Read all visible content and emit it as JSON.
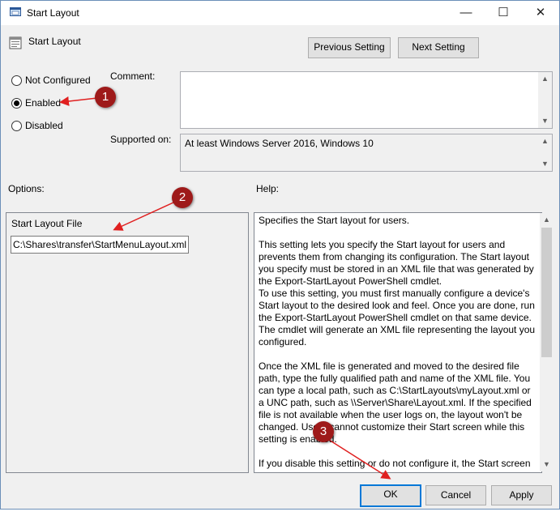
{
  "window": {
    "title": "Start Layout",
    "minimize": "—",
    "maximize": "☐",
    "close": "✕"
  },
  "header": {
    "setting_name": "Start Layout"
  },
  "nav": {
    "previous": "Previous Setting",
    "next": "Next Setting"
  },
  "state": {
    "options": [
      {
        "label": "Not Configured",
        "selected": false
      },
      {
        "label": "Enabled",
        "selected": true
      },
      {
        "label": "Disabled",
        "selected": false
      }
    ]
  },
  "comment": {
    "label": "Comment:",
    "value": ""
  },
  "supported": {
    "label": "Supported on:",
    "value": "At least Windows Server 2016, Windows 10"
  },
  "options_panel": {
    "label": "Options:",
    "field_label": "Start Layout File",
    "field_value": "C:\\Shares\\transfer\\StartMenuLayout.xml"
  },
  "help_panel": {
    "label": "Help:",
    "paragraphs": [
      "Specifies the Start layout for users.",
      "This setting lets you specify the Start layout for users and prevents them from changing its configuration. The Start layout you specify must be stored in an XML file that was generated by the Export-StartLayout PowerShell cmdlet.",
      "To use this setting, you must first manually configure a device's Start layout to the desired look and feel. Once you are done, run the Export-StartLayout PowerShell cmdlet on that same device. The cmdlet will generate an XML file representing the layout you configured.",
      "Once the XML file is generated and moved to the desired file path, type the fully qualified path and name of the XML file. You can type a local path, such as C:\\StartLayouts\\myLayout.xml or a UNC path, such as \\\\Server\\Share\\Layout.xml. If the specified file is not available when the user logs on, the layout won't be changed. Users cannot customize their Start screen while this setting is enabled.",
      "If you disable this setting or do not configure it, the Start screen"
    ]
  },
  "footer": {
    "ok": "OK",
    "cancel": "Cancel",
    "apply": "Apply"
  },
  "annotations": {
    "m1": "1",
    "m2": "2",
    "m3": "3",
    "accent": "#9e1a1a"
  }
}
